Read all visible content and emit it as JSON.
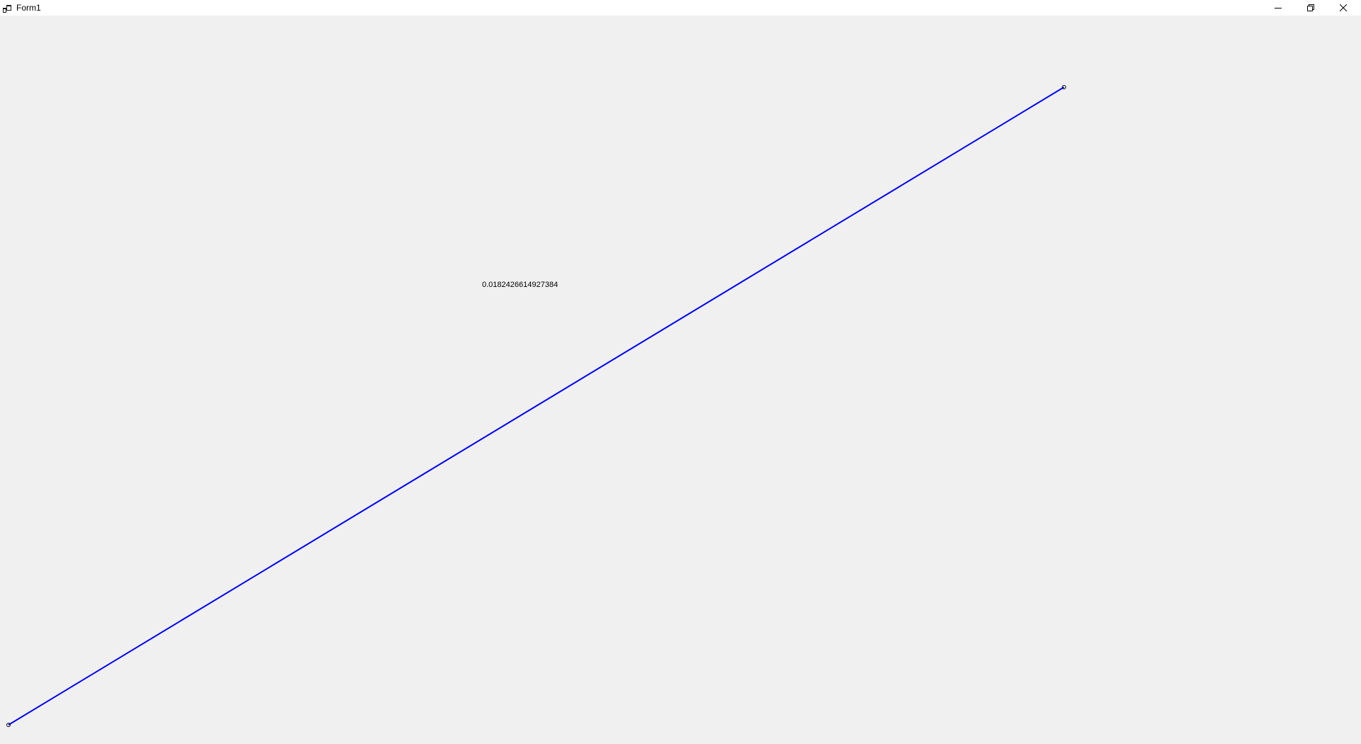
{
  "window": {
    "title": "Form1",
    "controls": {
      "minimize_icon": "minimize-icon",
      "restore_icon": "restore-icon",
      "close_icon": "close-icon"
    }
  },
  "client": {
    "value_text": "0.0182426614927384",
    "line_color": "#0000ff",
    "background": "#f0f0f0"
  }
}
